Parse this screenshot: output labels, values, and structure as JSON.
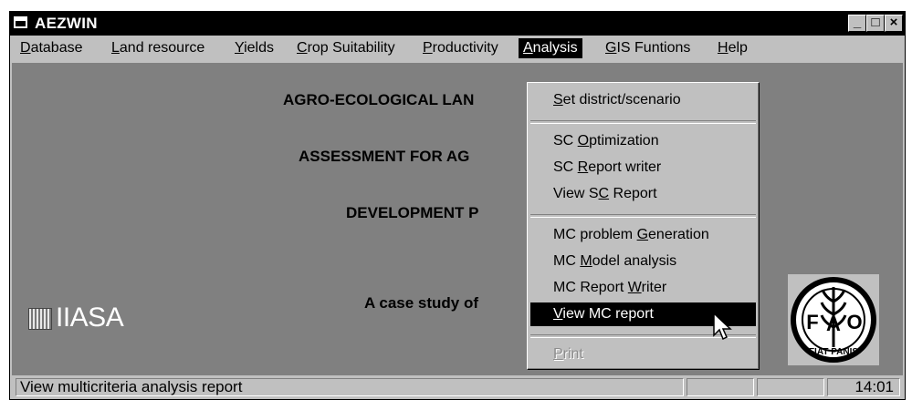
{
  "window": {
    "title": "AEZWIN",
    "controls": {
      "minimize": "_",
      "maximize": "□",
      "close": "×"
    }
  },
  "menu": [
    {
      "before": "",
      "key": "D",
      "after": "atabase"
    },
    {
      "before": "",
      "key": "L",
      "after": "and resource"
    },
    {
      "before": "",
      "key": "Y",
      "after": "ields"
    },
    {
      "before": "",
      "key": "C",
      "after": "rop Suitability"
    },
    {
      "before": "",
      "key": "P",
      "after": "roductivity"
    },
    {
      "before": "",
      "key": "A",
      "after": "nalysis"
    },
    {
      "before": "",
      "key": "G",
      "after": "IS Funtions"
    },
    {
      "before": "",
      "key": "H",
      "after": "elp"
    }
  ],
  "content": {
    "heading1": "AGRO-ECOLOGICAL LAN",
    "heading2": "ASSESSMENT FOR AG",
    "heading3": "DEVELOPMENT P",
    "heading4": "A case study of",
    "iiasa_logo": "IIASA",
    "fao_logo": {
      "letters": "FAO",
      "motto": "FIAT PANIS"
    }
  },
  "analysis_menu": [
    {
      "before": "",
      "key": "S",
      "after": "et district/scenario"
    },
    {
      "before": "SC ",
      "key": "O",
      "after": "ptimization"
    },
    {
      "before": "SC ",
      "key": "R",
      "after": "eport  writer"
    },
    {
      "before": "View S",
      "key": "C",
      "after": " Report"
    },
    {
      "before": "MC problem ",
      "key": "G",
      "after": "eneration"
    },
    {
      "before": "MC ",
      "key": "M",
      "after": "odel analysis"
    },
    {
      "before": "MC Report  ",
      "key": "W",
      "after": "riter"
    },
    {
      "before": "",
      "key": "V",
      "after": "iew MC report"
    },
    {
      "before": "",
      "key": "P",
      "after": "rint"
    }
  ],
  "status": {
    "message": "View multicriteria analysis report",
    "panel2": "",
    "panel3": "",
    "time": "14:01"
  },
  "colors": {
    "titlebar": "#000000",
    "face": "#c0c0c0",
    "client": "#808080",
    "highlight": "#000000"
  }
}
